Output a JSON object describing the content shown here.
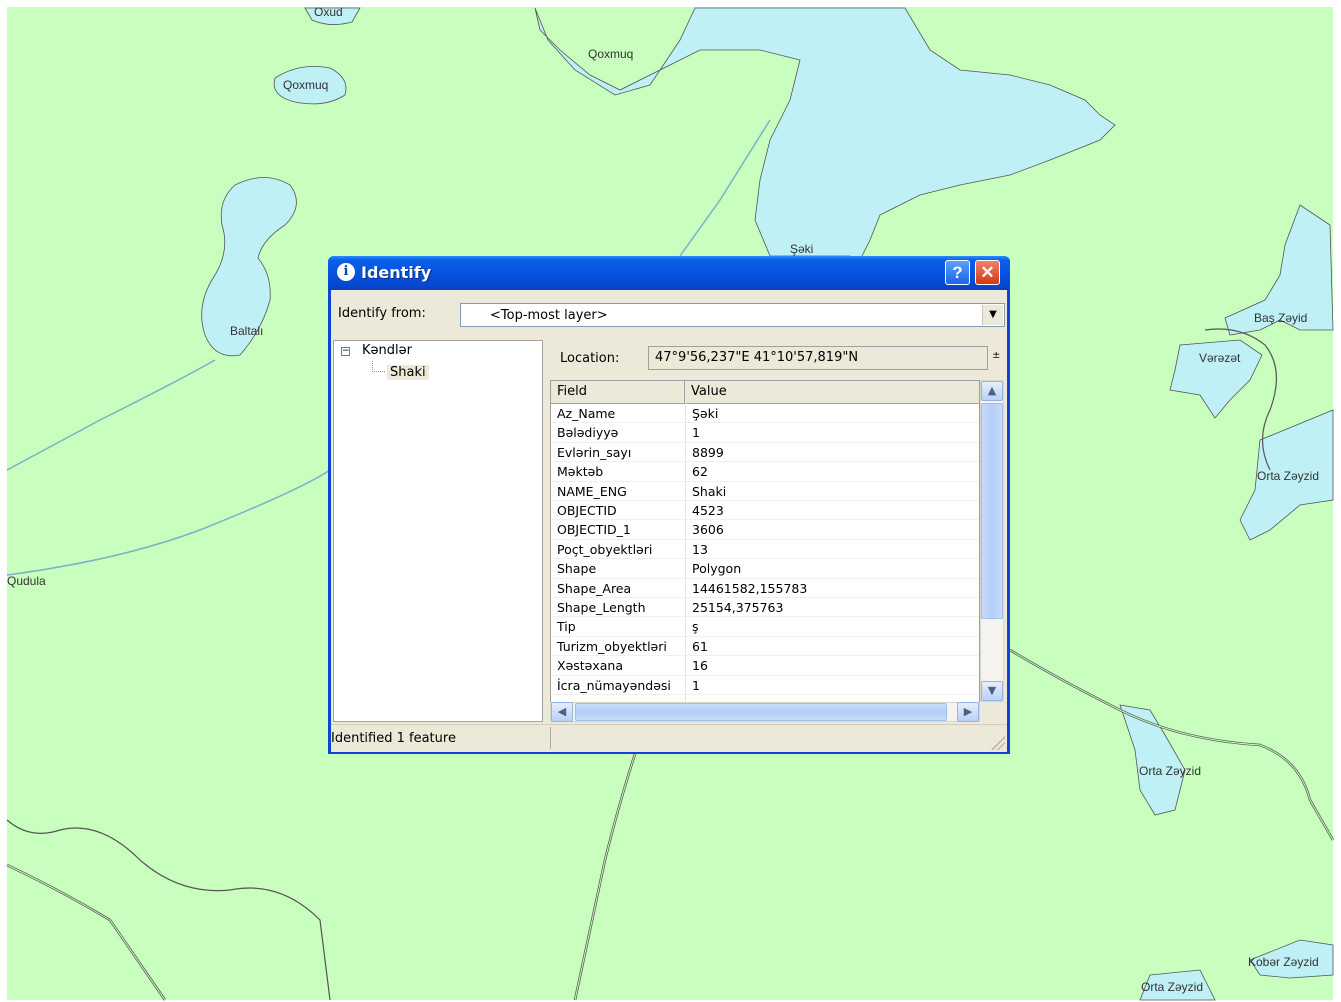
{
  "map": {
    "labels": [
      "Oxud",
      "Qoxmuq",
      "Qoxmuq",
      "Baltalı",
      "Şəki",
      "Baş Zəyid",
      "Vərəzət",
      "Orta Zəyzid",
      "Qudula",
      "Orta Zəyzid",
      "Kobər Zəyzid",
      "Orta Zəyzid"
    ],
    "colors": {
      "land": "#c8ffbe",
      "water": "#bef0f5",
      "roads": "#555555"
    }
  },
  "window": {
    "title": "Identify",
    "title_icon": "info-icon",
    "help_label": "?",
    "close_label": "✕",
    "identify_from_label": "Identify from:",
    "identify_from_value": "<Top-most layer>",
    "tree": {
      "layer": "Kəndlər",
      "feature": "Shaki",
      "expander": "−"
    },
    "location_label": "Location:",
    "location_value": "47°9'56,237\"E  41°10'57,819\"N",
    "grid": {
      "headers": [
        "Field",
        "Value"
      ],
      "rows": [
        [
          "Az_Name",
          "Şəki"
        ],
        [
          "Bələdiyyə",
          "1"
        ],
        [
          "Evlərin_sayı",
          "8899"
        ],
        [
          "Məktəb",
          "62"
        ],
        [
          "NAME_ENG",
          "Shaki"
        ],
        [
          "OBJECTID",
          "4523"
        ],
        [
          "OBJECTID_1",
          "3606"
        ],
        [
          "Poçt_obyektləri",
          "13"
        ],
        [
          "Shape",
          "Polygon"
        ],
        [
          "Shape_Area",
          "14461582,155783"
        ],
        [
          "Shape_Length",
          "25154,375763"
        ],
        [
          "Tip",
          "ş"
        ],
        [
          "Turizm_obyektləri",
          "61"
        ],
        [
          "Xəstəxana",
          "16"
        ],
        [
          "İcra_nümayəndəsi",
          "1"
        ]
      ]
    },
    "status": "Identified 1 feature",
    "colors": {
      "titlebar": "#0653e0",
      "close": "#d23a12",
      "face": "#ece9d8"
    }
  }
}
